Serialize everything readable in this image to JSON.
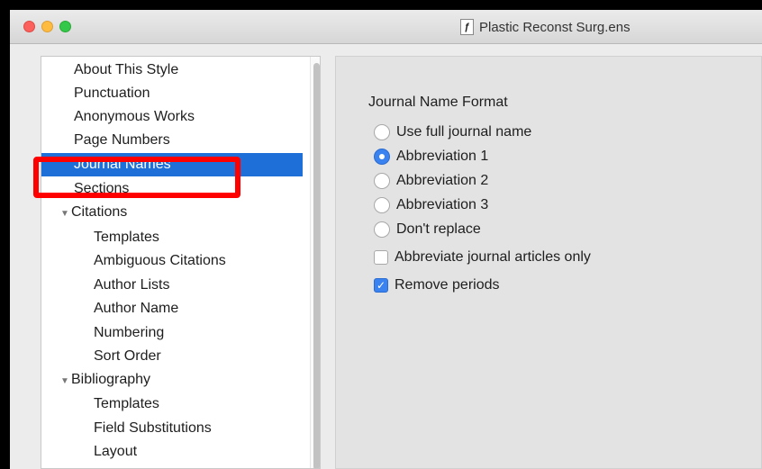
{
  "window": {
    "title": "Plastic Reconst Surg.ens",
    "doc_icon_glyph": "ƒ"
  },
  "sidebar": {
    "items": [
      {
        "label": "About This Style",
        "level": 0
      },
      {
        "label": "Punctuation",
        "level": 0
      },
      {
        "label": "Anonymous Works",
        "level": 0
      },
      {
        "label": "Page Numbers",
        "level": 0
      },
      {
        "label": "Journal Names",
        "level": 0,
        "selected": true
      },
      {
        "label": "Sections",
        "level": 0
      },
      {
        "label": "Citations",
        "level": 0,
        "disclosure": "▼"
      },
      {
        "label": "Templates",
        "level": 1
      },
      {
        "label": "Ambiguous Citations",
        "level": 1
      },
      {
        "label": "Author Lists",
        "level": 1
      },
      {
        "label": "Author Name",
        "level": 1
      },
      {
        "label": "Numbering",
        "level": 1
      },
      {
        "label": "Sort Order",
        "level": 1
      },
      {
        "label": "Bibliography",
        "level": 0,
        "disclosure": "▼"
      },
      {
        "label": "Templates",
        "level": 1
      },
      {
        "label": "Field Substitutions",
        "level": 1
      },
      {
        "label": "Layout",
        "level": 1
      }
    ]
  },
  "main": {
    "group_title": "Journal Name Format",
    "radio_options": [
      {
        "label": "Use full journal name",
        "checked": false
      },
      {
        "label": "Abbreviation 1",
        "checked": true
      },
      {
        "label": "Abbreviation 2",
        "checked": false
      },
      {
        "label": "Abbreviation 3",
        "checked": false
      },
      {
        "label": "Don't replace",
        "checked": false
      }
    ],
    "checkboxes": [
      {
        "label": "Abbreviate journal articles only",
        "checked": false
      },
      {
        "label": "Remove periods",
        "checked": true
      }
    ]
  },
  "colors": {
    "selection": "#1f6fd8",
    "annotation_box": "#ff0000",
    "control_accent": "#3a82f0"
  }
}
